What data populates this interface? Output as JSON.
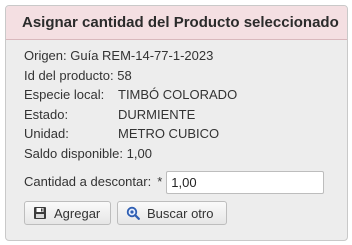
{
  "panel": {
    "title": "Asignar cantidad del Producto seleccionado"
  },
  "details": {
    "origen": "Origen: Guía REM-14-77-1-2023",
    "id_producto": "Id del producto: 58",
    "especie_label": "Especie local:",
    "especie_value": "TIMBÓ COLORADO",
    "estado_label": "Estado:",
    "estado_value": "DURMIENTE",
    "unidad_label": "Unidad:",
    "unidad_value": "METRO CUBICO",
    "saldo": "Saldo disponible: 1,00"
  },
  "form": {
    "cantidad_label": "Cantidad a descontar:",
    "required_mark": "*",
    "cantidad_value": "1,00"
  },
  "buttons": {
    "agregar_label": "Agregar",
    "agregar_icon": "floppy-disk-icon",
    "buscar_label": "Buscar otro",
    "buscar_icon": "magnifier-icon"
  },
  "colors": {
    "header_bg": "#f4dfe2",
    "panel_bg": "#ededed",
    "icon_blue": "#2f5fb3"
  }
}
